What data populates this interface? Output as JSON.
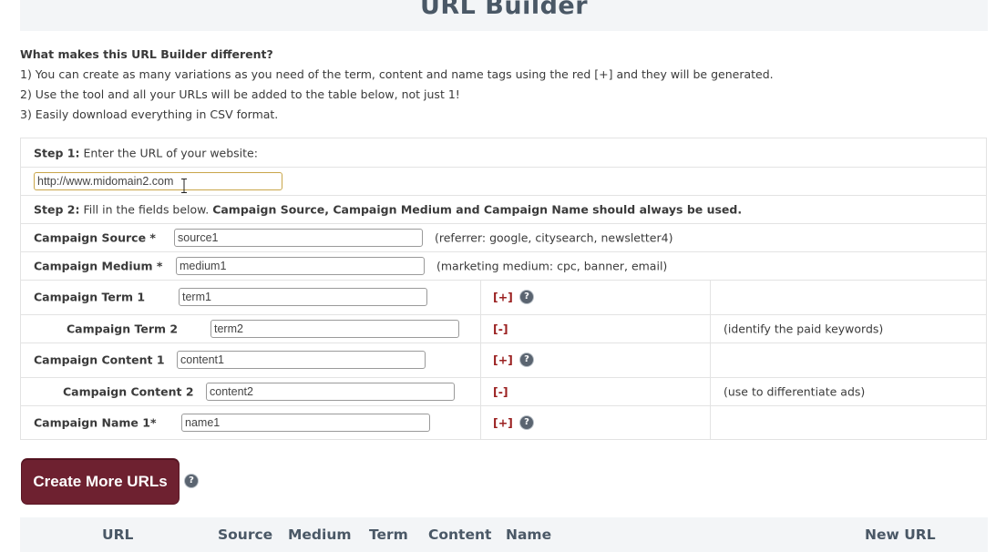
{
  "page": {
    "title": "URL Builder"
  },
  "intro": {
    "heading": "What makes this URL Builder different?",
    "lines": [
      "1) You can create as many variations as you need of the term, content and name tags using the red [+] and they will be generated.",
      "2) Use the tool and all your URLs will be added to the table below, not just 1!",
      "3) Easily download everything in CSV format."
    ]
  },
  "step1": {
    "label": "Step 1:",
    "text": "Enter the URL of your website:",
    "url_value": "http://www.midomain2.com"
  },
  "step2": {
    "label": "Step 2:",
    "text": "Fill in the fields below.",
    "bold_text": "Campaign Source, Campaign Medium and Campaign Name should always be used."
  },
  "fields": {
    "source": {
      "label": "Campaign Source *",
      "value": "source1",
      "hint": "(referrer: google, citysearch, newsletter4)"
    },
    "medium": {
      "label": "Campaign Medium *",
      "value": "medium1",
      "hint": "(marketing medium: cpc, banner, email)"
    },
    "term1": {
      "label": "Campaign Term 1",
      "value": "term1",
      "action": "[+]"
    },
    "term2": {
      "label": "Campaign Term 2",
      "value": "term2",
      "action": "[-]",
      "hint": "(identify the paid keywords)"
    },
    "content1": {
      "label": "Campaign Content 1",
      "value": "content1",
      "action": "[+]"
    },
    "content2": {
      "label": "Campaign Content 2",
      "value": "content2",
      "action": "[-]",
      "hint": "(use to differentiate ads)"
    },
    "name1": {
      "label": "Campaign Name 1*",
      "value": "name1",
      "action": "[+]"
    }
  },
  "help_icon": "question-circle-icon",
  "create_button": {
    "label": "Create More URLs"
  },
  "results": {
    "columns": [
      "URL",
      "Source",
      "Medium",
      "Term",
      "Content",
      "Name",
      "New URL"
    ]
  },
  "colors": {
    "button_bg": "#6e2130",
    "action_red": "#9a1f1f",
    "header_text": "#4a5866",
    "panel_bg": "#f3f5f7"
  }
}
